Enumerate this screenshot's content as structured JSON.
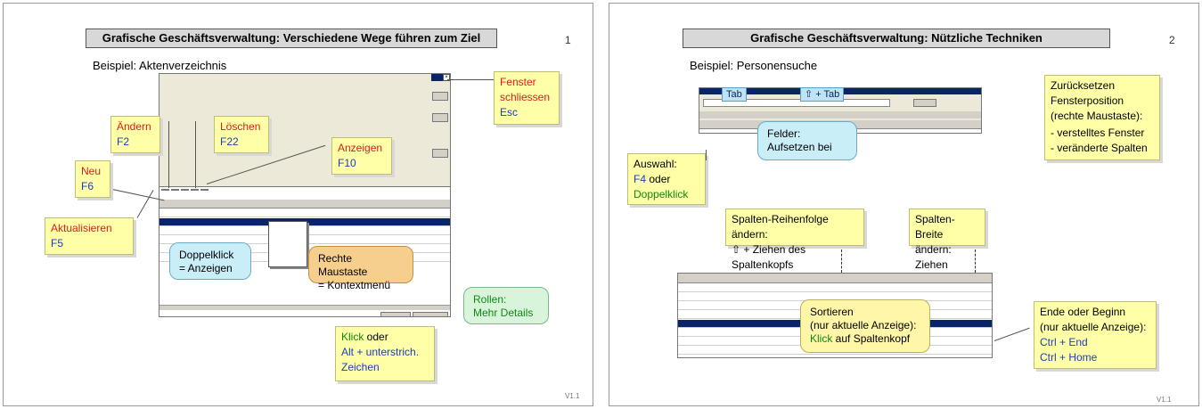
{
  "slide1": {
    "title": "Grafische Geschäftsverwaltung: Verschiedene Wege führen zum Ziel",
    "page": "1",
    "subtitle": "Beispiel: Aktenverzeichnis",
    "version": "V1.1",
    "notes": {
      "neu": {
        "action": "Neu",
        "key": "F6"
      },
      "aendern": {
        "action": "Ändern",
        "key": "F2"
      },
      "loeschen": {
        "action": "Löschen",
        "key": "F22"
      },
      "anzeigen": {
        "action": "Anzeigen",
        "key": "F10"
      },
      "aktualisieren": {
        "action": "Aktualisieren",
        "key": "F5"
      },
      "fenster": {
        "line1": "Fenster",
        "line2": "schliessen",
        "key": "Esc"
      },
      "klick": {
        "klick": "Klick",
        "oder": " oder",
        "line2": "Alt + unterstrich.",
        "line3": "Zeichen"
      }
    },
    "bubbles": {
      "doppelklick": {
        "line1": "Doppelklick",
        "line2": "= Anzeigen"
      },
      "rechte": {
        "line1": "Rechte Maustaste",
        "line2": "= Kontextmenü"
      },
      "rollen": {
        "line1": "Rollen:",
        "line2": "Mehr Details"
      }
    }
  },
  "slide2": {
    "title": "Grafische Geschäftsverwaltung: Nützliche Techniken",
    "page": "2",
    "subtitle": "Beispiel: Personensuche",
    "version": "V1.1",
    "tabs": {
      "tab1": "Tab",
      "tab2": "⇧ + Tab"
    },
    "bubbles": {
      "felder": {
        "line1": "Felder:",
        "line2": "Aufsetzen bei"
      },
      "sortieren": {
        "line1": "Sortieren",
        "line2": "(nur aktuelle Anzeige):",
        "klick": "Klick",
        "line3": " auf Spaltenkopf"
      }
    },
    "notes": {
      "zuruecksetzen": {
        "l1": "Zurücksetzen",
        "l2": "Fensterposition",
        "l3": "(rechte Maustaste):",
        "l4": "- verstelltes Fenster",
        "l5": "- veränderte Spalten"
      },
      "auswahl": {
        "l1": "Auswahl:",
        "f4": "F4",
        "oder": " oder",
        "doppelklick": "Doppelklick"
      },
      "reihenfolge": {
        "l1": "Spalten-Reihenfolge ändern:",
        "l2": "⇧ + Ziehen des Spaltenkopfs"
      },
      "breite": {
        "l1": "Spalten-Breite",
        "l2": "ändern: Ziehen"
      },
      "ende": {
        "l1": "Ende oder Beginn",
        "l2": "(nur aktuelle Anzeige):",
        "l3": "Ctrl + End",
        "l4": "Ctrl + Home"
      }
    }
  }
}
